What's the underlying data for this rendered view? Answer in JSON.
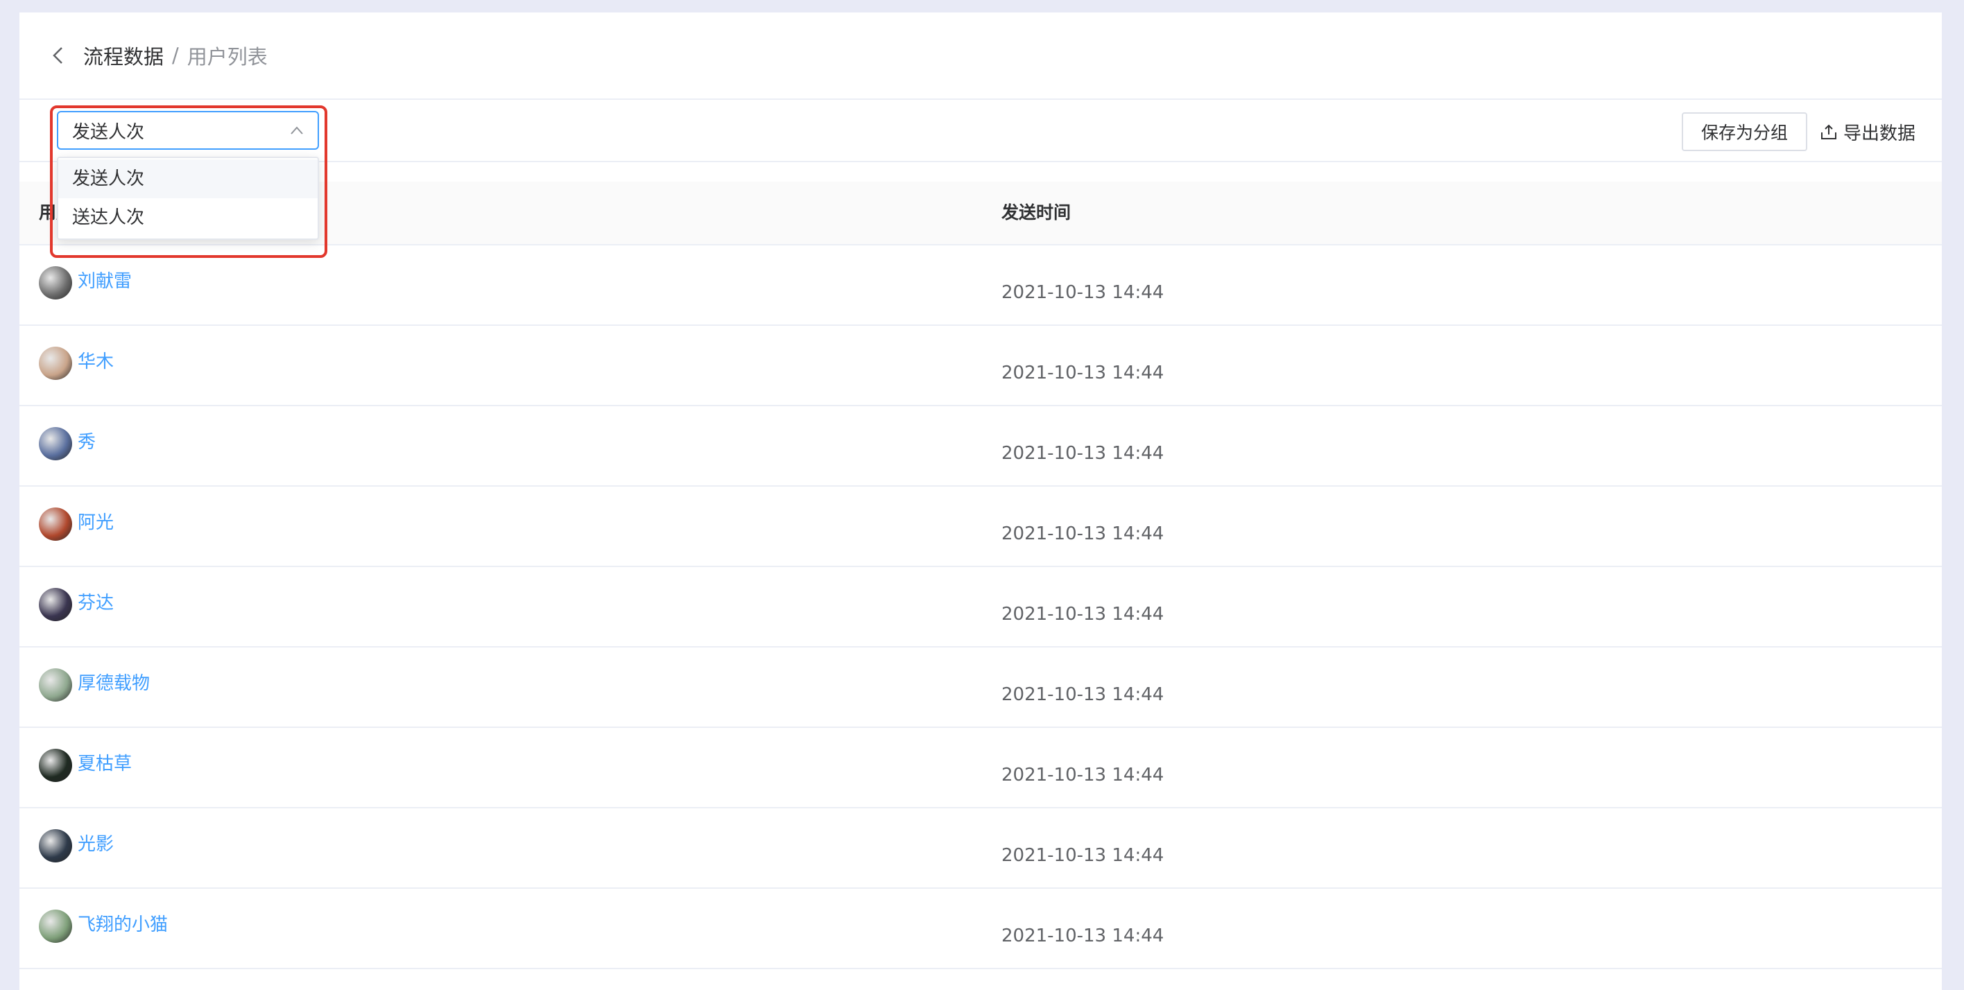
{
  "breadcrumb": {
    "current": "流程数据",
    "separator": "/",
    "page": "用户列表"
  },
  "toolbar": {
    "select_value": "发送人次",
    "save_group_label": "保存为分组",
    "export_label": "导出数据"
  },
  "dropdown": {
    "options": [
      "发送人次",
      "送达人次"
    ],
    "selected_index": 0
  },
  "table": {
    "columns": {
      "user": "用户",
      "time": "发送时间"
    },
    "rows": [
      {
        "name": "刘献雷",
        "time": "2021-10-13 14:44",
        "avatar_color": "#6d6d6d"
      },
      {
        "name": "华木",
        "time": "2021-10-13 14:44",
        "avatar_color": "#c9a48a"
      },
      {
        "name": "秀",
        "time": "2021-10-13 14:44",
        "avatar_color": "#5a6f9e"
      },
      {
        "name": "阿光",
        "time": "2021-10-13 14:44",
        "avatar_color": "#b0482d"
      },
      {
        "name": "芬达",
        "time": "2021-10-13 14:44",
        "avatar_color": "#3a3550"
      },
      {
        "name": "厚德载物",
        "time": "2021-10-13 14:44",
        "avatar_color": "#8fa88f"
      },
      {
        "name": "夏枯草",
        "time": "2021-10-13 14:44",
        "avatar_color": "#1f2a22"
      },
      {
        "name": "光影",
        "time": "2021-10-13 14:44",
        "avatar_color": "#2e3a4a"
      },
      {
        "name": "飞翔的小猫",
        "time": "2021-10-13 14:44",
        "avatar_color": "#7fa07a"
      }
    ]
  },
  "colors": {
    "accent": "#409eff",
    "highlight": "#e2382d",
    "page_bg": "#e8eaf6"
  }
}
